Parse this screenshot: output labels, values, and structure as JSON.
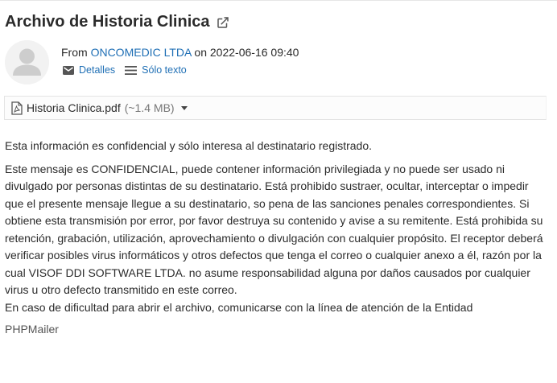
{
  "email": {
    "subject": "Archivo de Historia Clinica",
    "from_prefix": "From ",
    "sender": "ONCOMEDIC LTDA",
    "date_text": " on 2022-06-16 09:40",
    "actions": {
      "details_label": "Detalles",
      "plaintext_label": "Sólo texto"
    },
    "attachment": {
      "filename": "Historia Clinica.pdf",
      "size": "(~1.4 MB)"
    },
    "body": {
      "p1": "Esta información es confidencial y sólo interesa al destinatario registrado.",
      "p2": "Este mensaje es CONFIDENCIAL, puede contener información privilegiada y no puede ser usado ni divulgado por personas distintas de su destinatario. Está prohibido sustraer, ocultar, interceptar o impedir que el presente mensaje llegue a su destinatario, so pena de las sanciones penales correspondientes. Si obtiene esta transmisión por error, por favor destruya su contenido y avise a su remitente. Está prohibida su retención, grabación, utilización, aprovechamiento o divulgación con cualquier propósito. El receptor deberá verificar posibles virus informáticos y otros defectos que tenga el correo o cualquier anexo a él, razón por la cual VISOF DDI SOFTWARE LTDA. no asume responsabilidad alguna por daños causados por cualquier virus u otro defecto transmitido en este correo.",
      "p3": "En caso de dificultad para abrir el archivo, comunicarse con la línea de atención de la Entidad"
    },
    "signature": "PHPMailer"
  },
  "colors": {
    "link": "#1f6fb5",
    "text": "#2b2b2b",
    "muted": "#777777"
  },
  "icons": [
    "external-link-icon",
    "envelope-icon",
    "menu-lines-icon",
    "pdf-file-icon",
    "caret-down-icon",
    "avatar-placeholder"
  ]
}
